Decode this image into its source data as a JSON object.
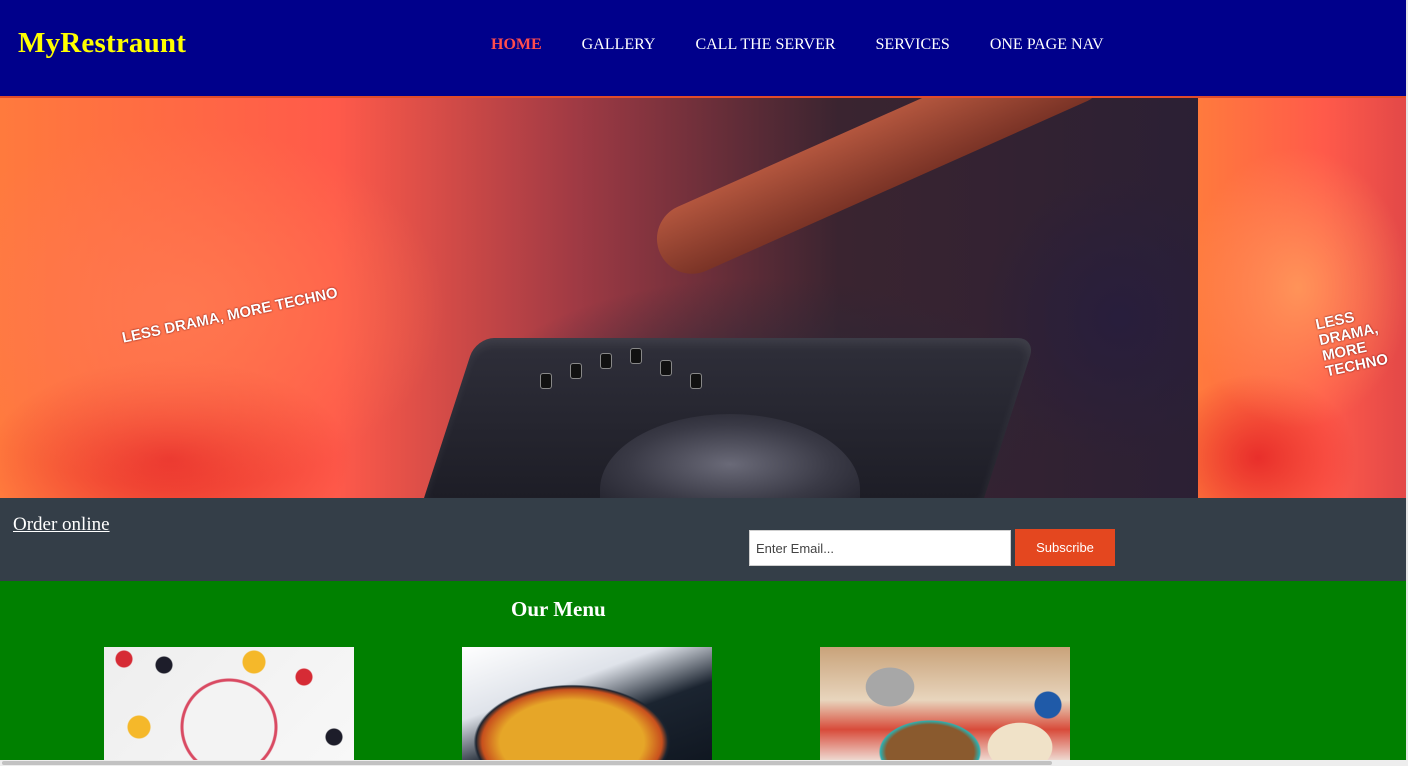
{
  "header": {
    "brand": "MyRestraunt",
    "nav": [
      {
        "label": "HOME",
        "active": true
      },
      {
        "label": "GALLERY",
        "active": false
      },
      {
        "label": "CALL THE SERVER",
        "active": false
      },
      {
        "label": "SERVICES",
        "active": false
      },
      {
        "label": "ONE PAGE NAV",
        "active": false
      }
    ]
  },
  "hero": {
    "poster_text": "LESS DRAMA, MORE TECHNO"
  },
  "subscribe": {
    "order_link": "Order online",
    "email_placeholder": "Enter Email...",
    "email_value": "",
    "button_label": "Subscribe"
  },
  "menu": {
    "title": "Our Menu"
  },
  "colors": {
    "header_bg": "#00008b",
    "brand": "#ffff00",
    "nav_active": "#ff4d4d",
    "subscribe_bar": "#343e48",
    "subscribe_button": "#e4471f",
    "menu_bg": "#008000"
  }
}
